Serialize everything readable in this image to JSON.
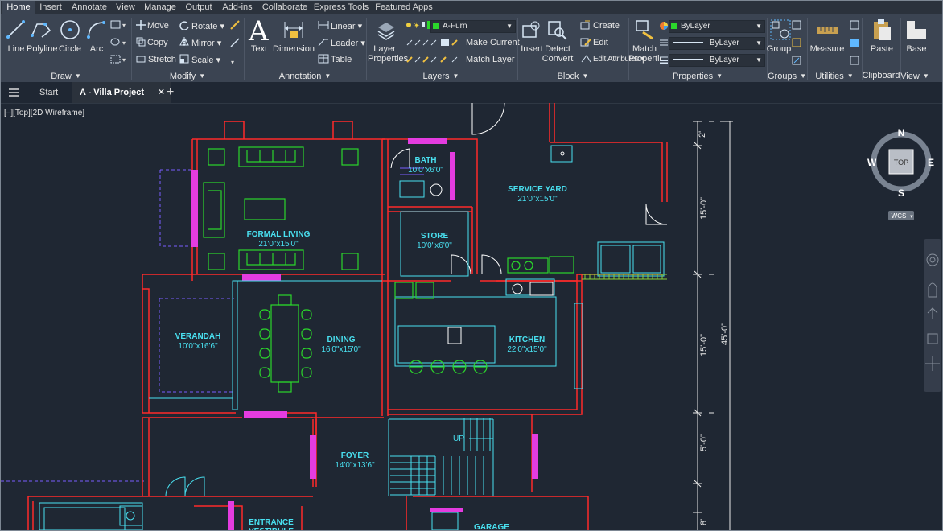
{
  "menu": {
    "tabs": [
      "Home",
      "Insert",
      "Annotate",
      "View",
      "Manage",
      "Output",
      "Add-ins",
      "Collaborate",
      "Express Tools",
      "Featured Apps"
    ],
    "active": "Home"
  },
  "ribbon": {
    "draw": {
      "title": "Draw",
      "tools": [
        "Line",
        "Polyline",
        "Circle",
        "Arc"
      ]
    },
    "modify": {
      "title": "Modify",
      "items": [
        "Move",
        "Rotate",
        "Copy",
        "Mirror",
        "Stretch",
        "Scale"
      ]
    },
    "annotation": {
      "title": "Annotation",
      "text": "Text",
      "dimension": "Dimension",
      "items": [
        "Linear",
        "Leader",
        "Table"
      ]
    },
    "layers": {
      "title": "Layers",
      "layer_properties": "Layer\nProperties",
      "current_layer": "A-Furn",
      "items": [
        "Make Current",
        "Match Layer"
      ]
    },
    "block": {
      "title": "Block",
      "insert": "Insert",
      "detect": "Detect\nConvert",
      "items": [
        "Create",
        "Edit",
        "Edit Attributes"
      ]
    },
    "properties": {
      "title": "Properties",
      "match": "Match\nProperties",
      "color": "ByLayer",
      "linetype": "ByLayer",
      "lineweight": "ByLayer"
    },
    "groups": {
      "title": "Groups",
      "group": "Group"
    },
    "utilities": {
      "title": "Utilities",
      "measure": "Measure"
    },
    "clipboard": {
      "title": "Clipboard",
      "paste": "Paste"
    },
    "view": {
      "title": "View",
      "base": "Base"
    }
  },
  "filetabs": {
    "start": "Start",
    "active": "A - Villa Project"
  },
  "viewport": {
    "label": "[–][Top][2D Wireframe]"
  },
  "viewcube": {
    "north": "N",
    "south": "S",
    "east": "E",
    "west": "W",
    "face": "TOP",
    "wcs": "WCS"
  },
  "rooms": {
    "bath": {
      "name": "BATH",
      "size": "10'0\"x6'0\""
    },
    "service_yard": {
      "name": "SERVICE YARD",
      "size": "21'0\"x15'0\""
    },
    "formal_living": {
      "name": "FORMAL LIVING",
      "size": "21'0\"x15'0\""
    },
    "store": {
      "name": "STORE",
      "size": "10'0\"x6'0\""
    },
    "verandah": {
      "name": "VERANDAH",
      "size": "10'0\"x16'6\""
    },
    "dining": {
      "name": "DINING",
      "size": "16'0\"x15'0\""
    },
    "kitchen": {
      "name": "KITCHEN",
      "size": "22'0\"x15'0\""
    },
    "foyer": {
      "name": "FOYER",
      "size": "14'0\"x13'6\""
    },
    "entrance": {
      "name": "ENTRANCE\nVESTIBULE"
    },
    "garage": {
      "name": "GARAGE"
    },
    "up": "UP"
  },
  "dimensions": {
    "d1": "2'",
    "d2": "15'-0\"",
    "d3": "15'-0\"",
    "d4": "45'-0\"",
    "d5": "5'-0\"",
    "d6": "8'"
  },
  "colors": {
    "wall": "#ff2a2a",
    "furniture": "#2bd62b",
    "annotation": "#49e0f0",
    "door": "#e43ce0",
    "dashed": "#7a5cff"
  }
}
